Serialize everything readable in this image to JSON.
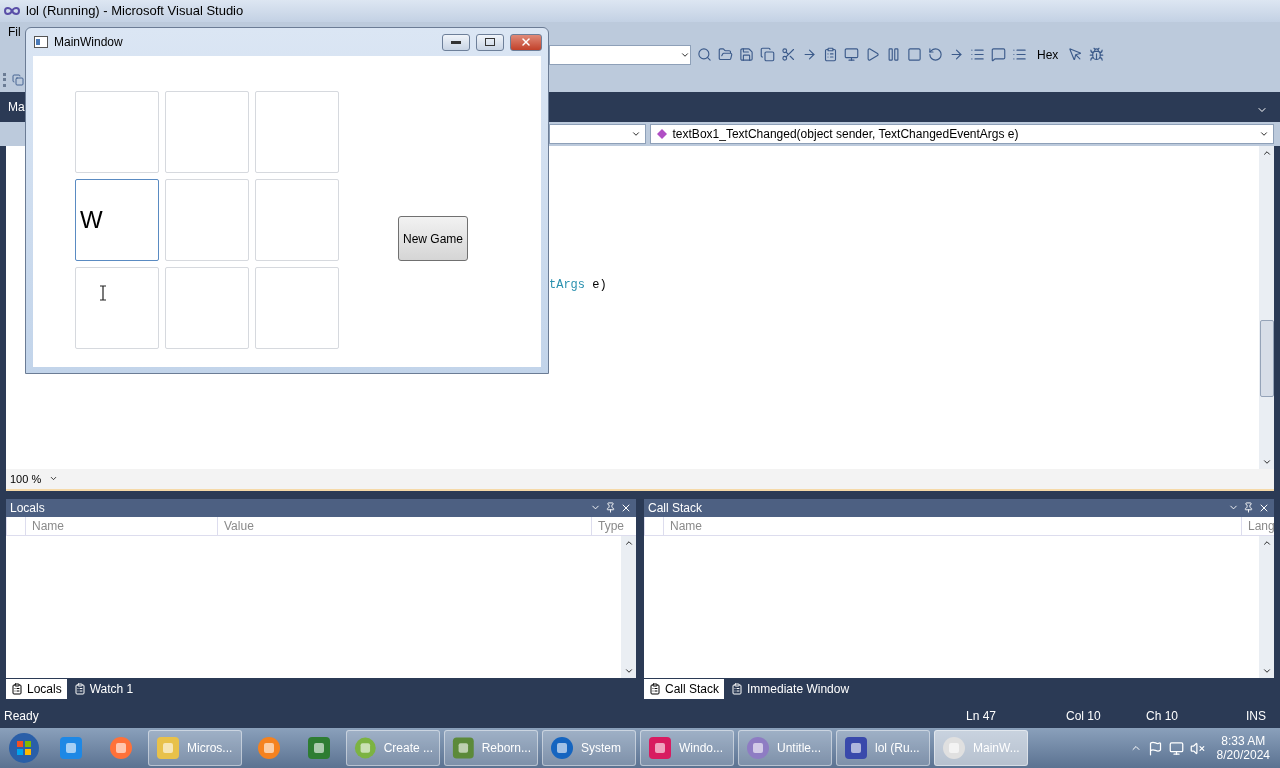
{
  "ide": {
    "title": "lol (Running) - Microsoft Visual Studio",
    "menu": [
      "Fil"
    ],
    "toolbar": {
      "hex_button": "Hex"
    },
    "document_tab": "Ma",
    "member_dropdown": "textBox1_TextChanged(object sender, TextChangedEventArgs e)",
    "code_line": [
      {
        "text": "tArgs",
        "kind": "type"
      },
      {
        "text": "e)",
        "kind": "plain"
      }
    ],
    "zoom": "100 %",
    "panels": [
      {
        "title": "Locals",
        "columns": [
          "Name",
          "Value",
          "Type"
        ],
        "tabs": [
          {
            "label": "Locals",
            "selected": true
          },
          {
            "label": "Watch 1",
            "selected": false
          }
        ]
      },
      {
        "title": "Call Stack",
        "columns": [
          "Name",
          "Lang"
        ],
        "tabs": [
          {
            "label": "Call Stack",
            "selected": true
          },
          {
            "label": "Immediate Window",
            "selected": false
          }
        ]
      }
    ],
    "status_bar": [
      "Ready",
      "Ln 47",
      "Col 10",
      "Ch 10",
      "INS"
    ]
  },
  "app_window": {
    "title": "MainWindow",
    "cells": [
      {
        "focused": false
      },
      {
        "focused": false
      },
      {
        "focused": false
      },
      {
        "value": "W",
        "focused": true
      },
      {
        "focused": false
      },
      {
        "focused": false
      },
      {
        "focused": false
      },
      {
        "focused": false
      },
      {
        "focused": false
      }
    ],
    "button": "New Game"
  },
  "taskbar": {
    "items": [
      {
        "kind": "pinned",
        "active": false
      },
      {
        "kind": "pinned",
        "active": false
      },
      {
        "kind": "task",
        "label": "Micros...",
        "active": false
      },
      {
        "kind": "pinned",
        "active": false
      },
      {
        "kind": "pinned",
        "active": false
      },
      {
        "kind": "task",
        "label": "Create ...",
        "active": false
      },
      {
        "kind": "task",
        "label": "Reborn...",
        "active": false
      },
      {
        "kind": "task",
        "label": "System",
        "active": false
      },
      {
        "kind": "task",
        "label": "Windo...",
        "active": false
      },
      {
        "kind": "task",
        "label": "Untitle...",
        "active": false
      },
      {
        "kind": "task",
        "label": "lol (Ru...",
        "active": false
      },
      {
        "kind": "task",
        "label": "MainW...",
        "active": true
      }
    ],
    "time": "8:33 AM",
    "date": "8/20/2024"
  }
}
